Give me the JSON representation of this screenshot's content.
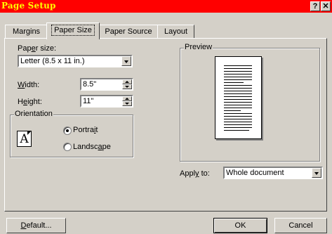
{
  "window": {
    "title": "Page Setup"
  },
  "titlebar": {
    "help_label": "?",
    "close_label": "✕"
  },
  "tabs": [
    {
      "label": "Margins",
      "active": false
    },
    {
      "label": "Paper Size",
      "active": true
    },
    {
      "label": "Paper Source",
      "active": false
    },
    {
      "label": "Layout",
      "active": false
    }
  ],
  "paper_size": {
    "label_pre": "Pap",
    "label_key": "e",
    "label_post": "r size:",
    "value": "Letter (8.5 x 11 in.)"
  },
  "width": {
    "label_key": "W",
    "label_post": "idth:",
    "value": "8.5\""
  },
  "height": {
    "label_pre": "H",
    "label_key": "e",
    "label_post": "ight:",
    "value": "11\""
  },
  "orientation": {
    "title": "Orientation",
    "icon_letter": "A",
    "portrait": {
      "label_pre": "Portra",
      "label_key": "i",
      "label_post": "t",
      "selected": true
    },
    "landscape": {
      "label_pre": "Landsc",
      "label_key": "a",
      "label_post": "pe",
      "selected": false
    }
  },
  "preview": {
    "title": "Preview"
  },
  "apply_to": {
    "label_pre": "Appl",
    "label_key": "y",
    "label_post": " to:",
    "value": "Whole document"
  },
  "buttons": {
    "default_key": "D",
    "default_post": "efault...",
    "ok": "OK",
    "cancel": "Cancel"
  }
}
